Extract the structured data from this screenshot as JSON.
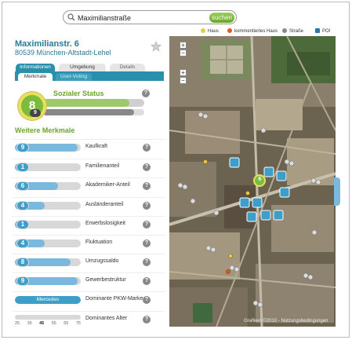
{
  "search": {
    "value": "Maximilianstraße",
    "button": "suchen"
  },
  "legend": [
    {
      "label": "Haus",
      "color": "#e9c84a",
      "icon": "house-dot"
    },
    {
      "label": "kommentiertes Haus",
      "color": "#e25b1f",
      "icon": "commented-house-dot"
    },
    {
      "label": "Straße",
      "color": "#8a8a8a",
      "icon": "street-dot"
    },
    {
      "label": "POI",
      "color": "#2b77a6",
      "icon": "poi-square"
    }
  ],
  "address": {
    "line1": "Maximilianstr. 6",
    "line2": "80539 München-Altstadt-Lehel"
  },
  "tabs": {
    "informationen": "Informationen",
    "umgebung": "Umgebung",
    "details": "Details"
  },
  "subtabs": {
    "merkmale": "Merkmale",
    "user_voting": "User-Voting"
  },
  "status": {
    "title": "Sozialer Status",
    "value": "8",
    "secondary": "9",
    "level": 0.85,
    "secondary_level": 0.9
  },
  "section_title": "Weitere Merkmale",
  "help": "?",
  "rows": [
    {
      "value": "9",
      "label": "Kaufkraft",
      "level": 0.95
    },
    {
      "value": "1",
      "label": "Familienanteil",
      "level": 0.1
    },
    {
      "value": "6",
      "label": "Akademiker-Anteil",
      "level": 0.65
    },
    {
      "value": "4",
      "label": "Ausländeranteil",
      "level": 0.45
    },
    {
      "value": "1",
      "label": "Erwerbslosigkeit",
      "level": 0.1
    },
    {
      "value": "4",
      "label": "Fluktuation",
      "level": 0.45
    },
    {
      "value": "8",
      "label": "Umzugssaldo",
      "level": 0.85
    },
    {
      "value": "9",
      "label": "Gewerbestruktur",
      "level": 0.95
    },
    {
      "value": "Mercedes",
      "label": "Dominante PKW-Marke",
      "level": 1.0
    },
    {
      "value": "",
      "label": "Dominantes Alter",
      "level": 0.0
    }
  ],
  "age_ticks": [
    "25",
    "35",
    "45",
    "55",
    "65",
    "75"
  ],
  "map": {
    "controls": [
      "+",
      "−",
      "+",
      "−"
    ],
    "copyright": "Grafiken ©2010 - Nutzungsbedingungen",
    "marker_value": "6",
    "accent": "#3f9ec9"
  }
}
